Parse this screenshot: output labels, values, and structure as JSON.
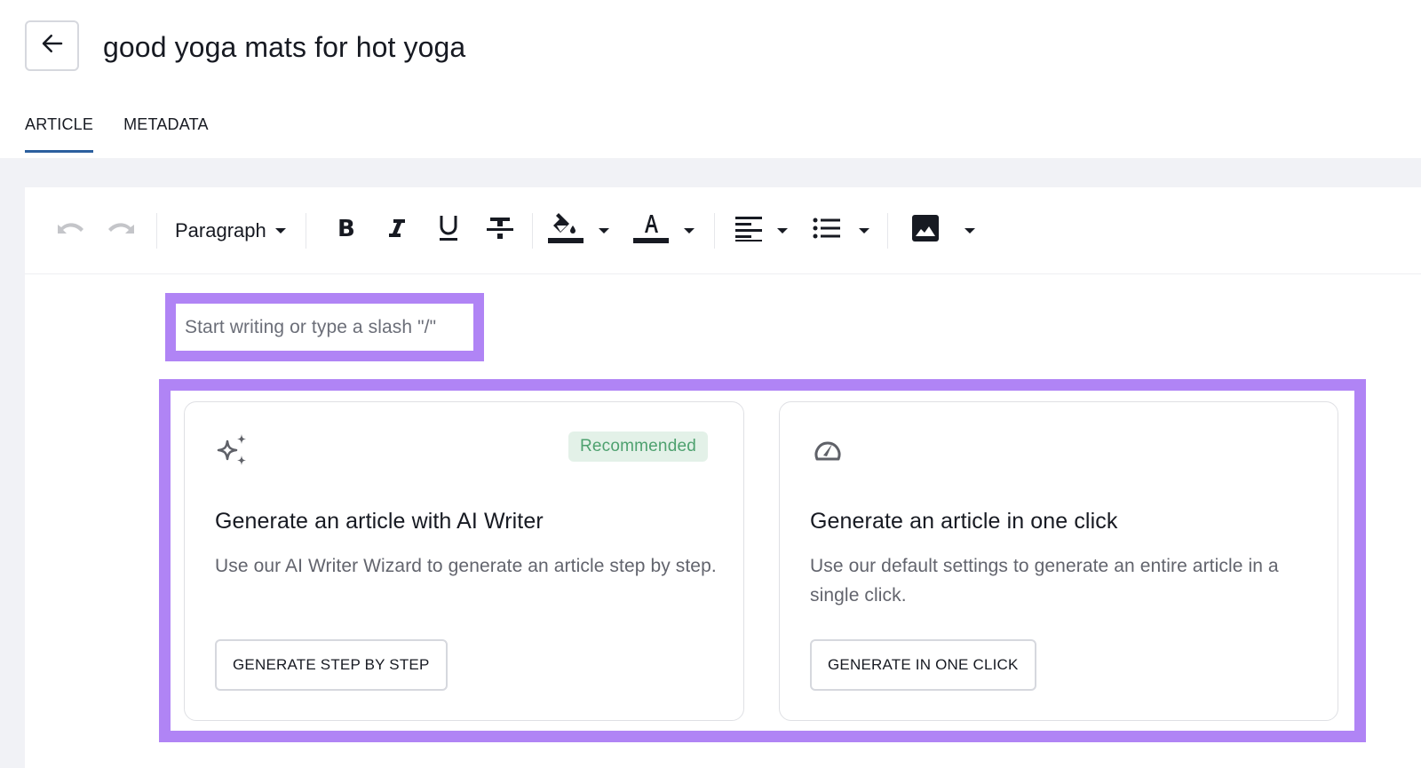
{
  "header": {
    "back_icon": "arrow-left-icon",
    "title": "good yoga mats for hot yoga"
  },
  "tabs": [
    {
      "label": "ARTICLE",
      "active": true
    },
    {
      "label": "METADATA",
      "active": false
    }
  ],
  "toolbar": {
    "undo_icon": "undo-icon",
    "redo_icon": "redo-icon",
    "block_format": "Paragraph",
    "bold_icon": "bold-icon",
    "italic_icon": "italic-icon",
    "underline_icon": "underline-icon",
    "strikethrough_icon": "strikethrough-icon",
    "highlight_icon": "fill-color-icon",
    "text_color_icon": "text-color-icon",
    "align_icon": "align-left-icon",
    "list_icon": "bulleted-list-icon",
    "image_icon": "image-icon"
  },
  "editor": {
    "placeholder": "Start writing or type a slash \"/\""
  },
  "cards": [
    {
      "icon": "sparkles-icon",
      "badge": "Recommended",
      "title": "Generate an article with AI Writer",
      "description": "Use our AI Writer Wizard to generate an article step by step.",
      "button": "GENERATE STEP BY STEP"
    },
    {
      "icon": "speedometer-icon",
      "title": "Generate an article in one click",
      "description": "Use our default settings to generate an entire article in a single click.",
      "button": "GENERATE IN ONE CLICK"
    }
  ],
  "colors": {
    "highlight_frame": "#b084f5",
    "tab_underline": "#2b5f9e",
    "badge_bg": "#e3f1e8",
    "badge_text": "#4ea16f",
    "canvas_bg": "#f1f2f6"
  }
}
